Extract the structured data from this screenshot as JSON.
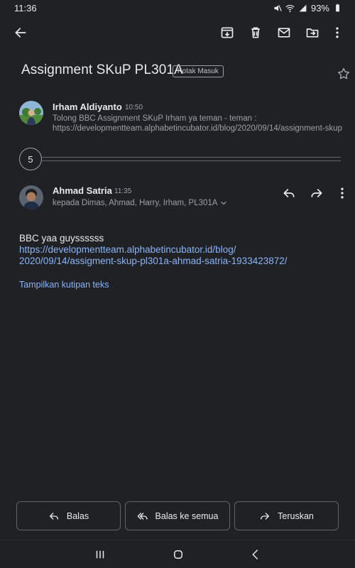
{
  "status_bar": {
    "time": "11:36",
    "battery": "93%"
  },
  "app_bar": {
    "icons": [
      "back-arrow-icon",
      "archive-icon",
      "delete-icon",
      "mark-unread-icon",
      "move-to-icon",
      "more-vert-icon"
    ]
  },
  "email": {
    "subject": "Assignment SKuP PL301A",
    "label": "Kotak Masuk"
  },
  "collapsed_message": {
    "sender": "Irham Aldiyanto",
    "time": "10:50",
    "snippet": "Tolong BBC Assignment SKuP Irham ya teman - teman : https://developmentteam.alphabetincubator.id/blog/2020/09/14/assignment-skup"
  },
  "hidden_messages": {
    "count": "5"
  },
  "open_message": {
    "sender": "Ahmad Satria",
    "time": "11:35",
    "recipients": "kepada Dimas, Ahmad, Harry, Irham, PL301A",
    "body_text": "BBC yaa guyssssss",
    "link_line1": "https://developmentteam.alphabetincubator.id/blog/",
    "link_line2": "2020/09/14/assigment-skup-pl301a-ahmad-satria-1933423872/",
    "show_quoted": "Tampilkan kutipan teks"
  },
  "actions": {
    "reply": "Balas",
    "reply_all": "Balas ke semua",
    "forward": "Teruskan"
  },
  "colors": {
    "background": "#202124",
    "text": "#e8eaed",
    "secondary": "#9aa0a6",
    "link": "#8ab4f8",
    "border": "#5f6368"
  }
}
